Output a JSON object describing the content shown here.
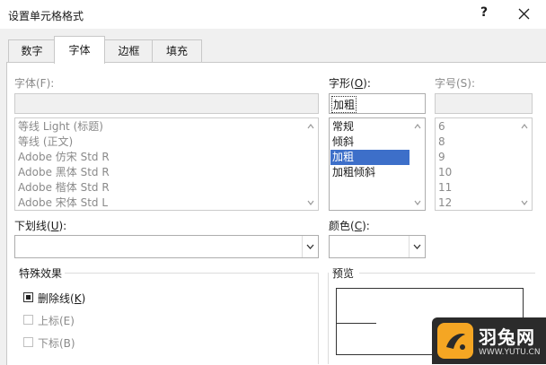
{
  "window": {
    "title": "设置单元格格式",
    "help_glyph": "?"
  },
  "tabs": [
    {
      "label": "数字",
      "active": false
    },
    {
      "label": "字体",
      "active": true
    },
    {
      "label": "边框",
      "active": false
    },
    {
      "label": "填充",
      "active": false
    }
  ],
  "font": {
    "label": "字体(F):",
    "value": "",
    "items": [
      "等线 Light (标题)",
      "等线 (正文)",
      "Adobe 仿宋 Std R",
      "Adobe 黑体 Std R",
      "Adobe 楷体 Std R",
      "Adobe 宋体 Std L"
    ]
  },
  "style": {
    "label_pre": "字形(",
    "label_key": "O",
    "label_post": "):",
    "value": "加粗",
    "items": [
      "常规",
      "倾斜",
      "加粗",
      "加粗倾斜"
    ],
    "selected_index": 2
  },
  "size": {
    "label": "字号(S):",
    "value": "",
    "items": [
      "6",
      "8",
      "9",
      "10",
      "11",
      "12"
    ]
  },
  "underline": {
    "label_pre": "下划线(",
    "label_key": "U",
    "label_post": "):",
    "value": ""
  },
  "color": {
    "label_pre": "颜色(",
    "label_key": "C",
    "label_post": "):",
    "value": ""
  },
  "effects": {
    "title": "特殊效果",
    "strikethrough": {
      "label_pre": "删除线(",
      "label_key": "K",
      "label_post": ")",
      "checked": true
    },
    "superscript": {
      "label": "上标(E)",
      "checked": false
    },
    "subscript": {
      "label": "下标(B)",
      "checked": false
    }
  },
  "preview": {
    "title": "预览"
  },
  "watermark": {
    "name": "羽兔网",
    "url": "WWW.YUTU.CN",
    "accent": "#f5a623",
    "bg": "#2b2b2b"
  },
  "colors": {
    "selection": "#3d6fc9"
  }
}
